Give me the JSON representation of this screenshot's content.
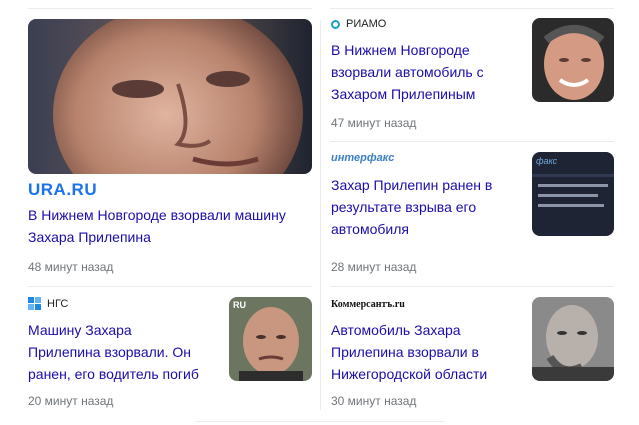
{
  "cards": [
    {
      "source": "URA.RU",
      "headline_lines": [
        "В Нижнем Новгороде взорвали машину",
        "Захара Прилепина"
      ],
      "time": "48 минут назад"
    },
    {
      "source": "РИАМО",
      "headline_lines": [
        "В Нижнем Новгороде",
        "взорвали автомобиль с",
        "Захаром Прилепиным"
      ],
      "time": "47 минут назад"
    },
    {
      "source": "интерфакс",
      "headline_lines": [
        "Захар Прилепин ранен в",
        "результате взрыва его",
        "автомобиля"
      ],
      "time": "28 минут назад"
    },
    {
      "source": "НГС",
      "headline_lines": [
        "Машину Захара",
        "Прилепина взорвали. Он",
        "ранен, его водитель погиб"
      ],
      "time": "20 минут назад"
    },
    {
      "source": "Коммерсантъ.ru",
      "headline_lines": [
        "Автомобиль Захара",
        "Прилепина взорвали в",
        "Нижегородской области"
      ],
      "time": "30 минут назад"
    }
  ],
  "thumb_badges": {
    "ngs": "RU",
    "interfax": "факс"
  },
  "colors": {
    "link": "#1a0dab",
    "meta": "#70757a",
    "ura": "#1a73e8",
    "interfax": "#3b7fc4"
  }
}
